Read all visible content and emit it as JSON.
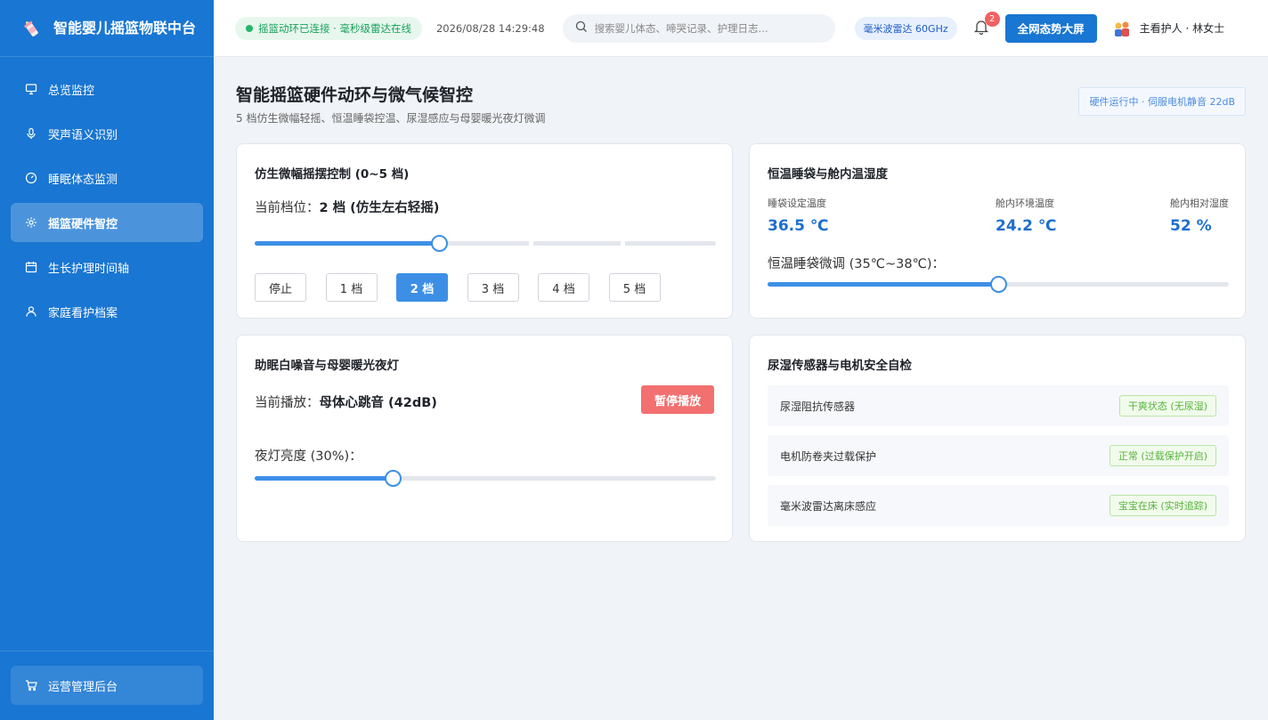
{
  "sidebar": {
    "brand_title": "智能婴儿摇篮物联中台",
    "items": [
      {
        "label": "总览监控",
        "icon": "monitor-icon",
        "active": false
      },
      {
        "label": "哭声语义识别",
        "icon": "microphone-icon",
        "active": false
      },
      {
        "label": "睡眠体态监测",
        "icon": "gauge-icon",
        "active": false
      },
      {
        "label": "摇篮硬件智控",
        "icon": "gear-icon",
        "active": true
      },
      {
        "label": "生长护理时间轴",
        "icon": "calendar-icon",
        "active": false
      },
      {
        "label": "家庭看护档案",
        "icon": "user-icon",
        "active": false
      }
    ],
    "bottom_item": {
      "label": "运营管理后台",
      "icon": "cart-icon"
    }
  },
  "header": {
    "connection_status": "摇篮动环已连接 · 毫秒级雷达在线",
    "datetime": "2026/08/28 14:29:48",
    "search_placeholder": "搜索婴儿体态、啼哭记录、护理日志...",
    "radar_badge": "毫米波雷达 60GHz",
    "notification_count": "2",
    "big_screen_label": "全网态势大屏",
    "user_label": "主看护人 · 林女士"
  },
  "page": {
    "title": "智能摇篮硬件动环与微气候智控",
    "subtitle": "5 档仿生微幅轻摇、恒温睡袋控温、尿湿感应与母婴暖光夜灯微调",
    "run_status": "硬件运行中 · 伺服电机静音 22dB"
  },
  "rocking": {
    "title": "仿生微幅摇摆控制 (0~5 档)",
    "status_prefix": "当前档位：",
    "status_value": "2 档 (仿生左右轻摇)",
    "level": 2,
    "max_level": 5,
    "buttons": [
      "停止",
      "1 档",
      "2 档",
      "3 档",
      "4 档",
      "5 档"
    ],
    "active_index": 2
  },
  "climate": {
    "title": "恒温睡袋与舱内温湿度",
    "metrics": [
      {
        "label": "睡袋设定温度",
        "value": "36.5 ℃"
      },
      {
        "label": "舱内环境温度",
        "value": "24.2 ℃"
      },
      {
        "label": "舱内相对湿度",
        "value": "52 %"
      }
    ],
    "slider_label": "恒温睡袋微调 (35℃~38℃)：",
    "slider_level": 0.5
  },
  "sound": {
    "title": "助眠白噪音与母婴暖光夜灯",
    "playing_prefix": "当前播放：",
    "playing_value": "母体心跳音 (42dB)",
    "pause_label": "暂停播放",
    "light_label": "夜灯亮度 (30%)：",
    "light_level": 0.3
  },
  "safety": {
    "title": "尿湿传感器与电机安全自检",
    "rows": [
      {
        "label": "尿湿阻抗传感器",
        "tag": "干爽状态 (无尿湿)"
      },
      {
        "label": "电机防卷夹过载保护",
        "tag": "正常 (过载保护开启)"
      },
      {
        "label": "毫米波雷达离床感应",
        "tag": "宝宝在床 (实时追踪)"
      }
    ]
  },
  "colors": {
    "primary": "#1976d2",
    "accent": "#3d8fe6",
    "danger": "#f27070",
    "success": "#56b33a"
  }
}
